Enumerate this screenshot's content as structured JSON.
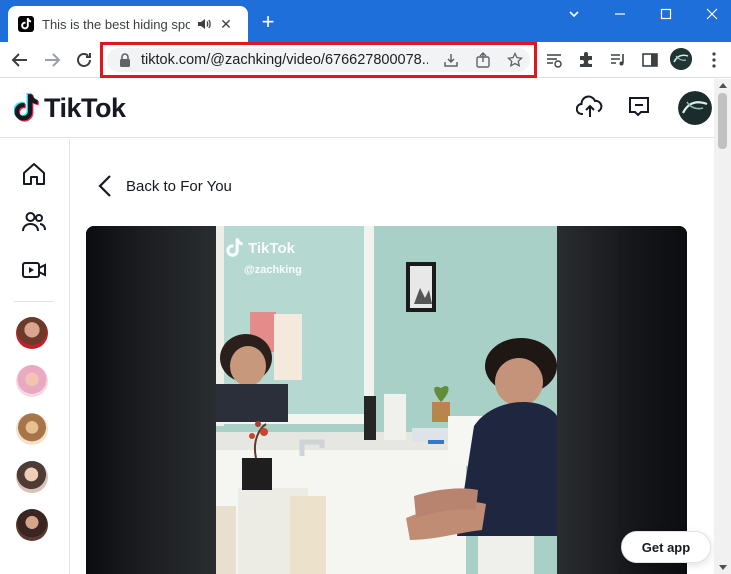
{
  "browser": {
    "tab": {
      "title": "This is the best hiding spot e",
      "close_glyph": "✕"
    },
    "new_tab_glyph": "+",
    "url": "tiktok.com/@zachking/video/676627800078...",
    "colors": {
      "tabstrip": "#1e6fd9",
      "highlight": "#e0161e"
    }
  },
  "tiktok": {
    "logo_text": "TikTok",
    "back_label": "Back to For You",
    "watermark_brand": "TikTok",
    "watermark_user": "@zachking",
    "get_app_label": "Get app",
    "colors": {
      "accent": "#fe2c55",
      "cyan": "#25f4ee",
      "text": "#161823"
    }
  }
}
